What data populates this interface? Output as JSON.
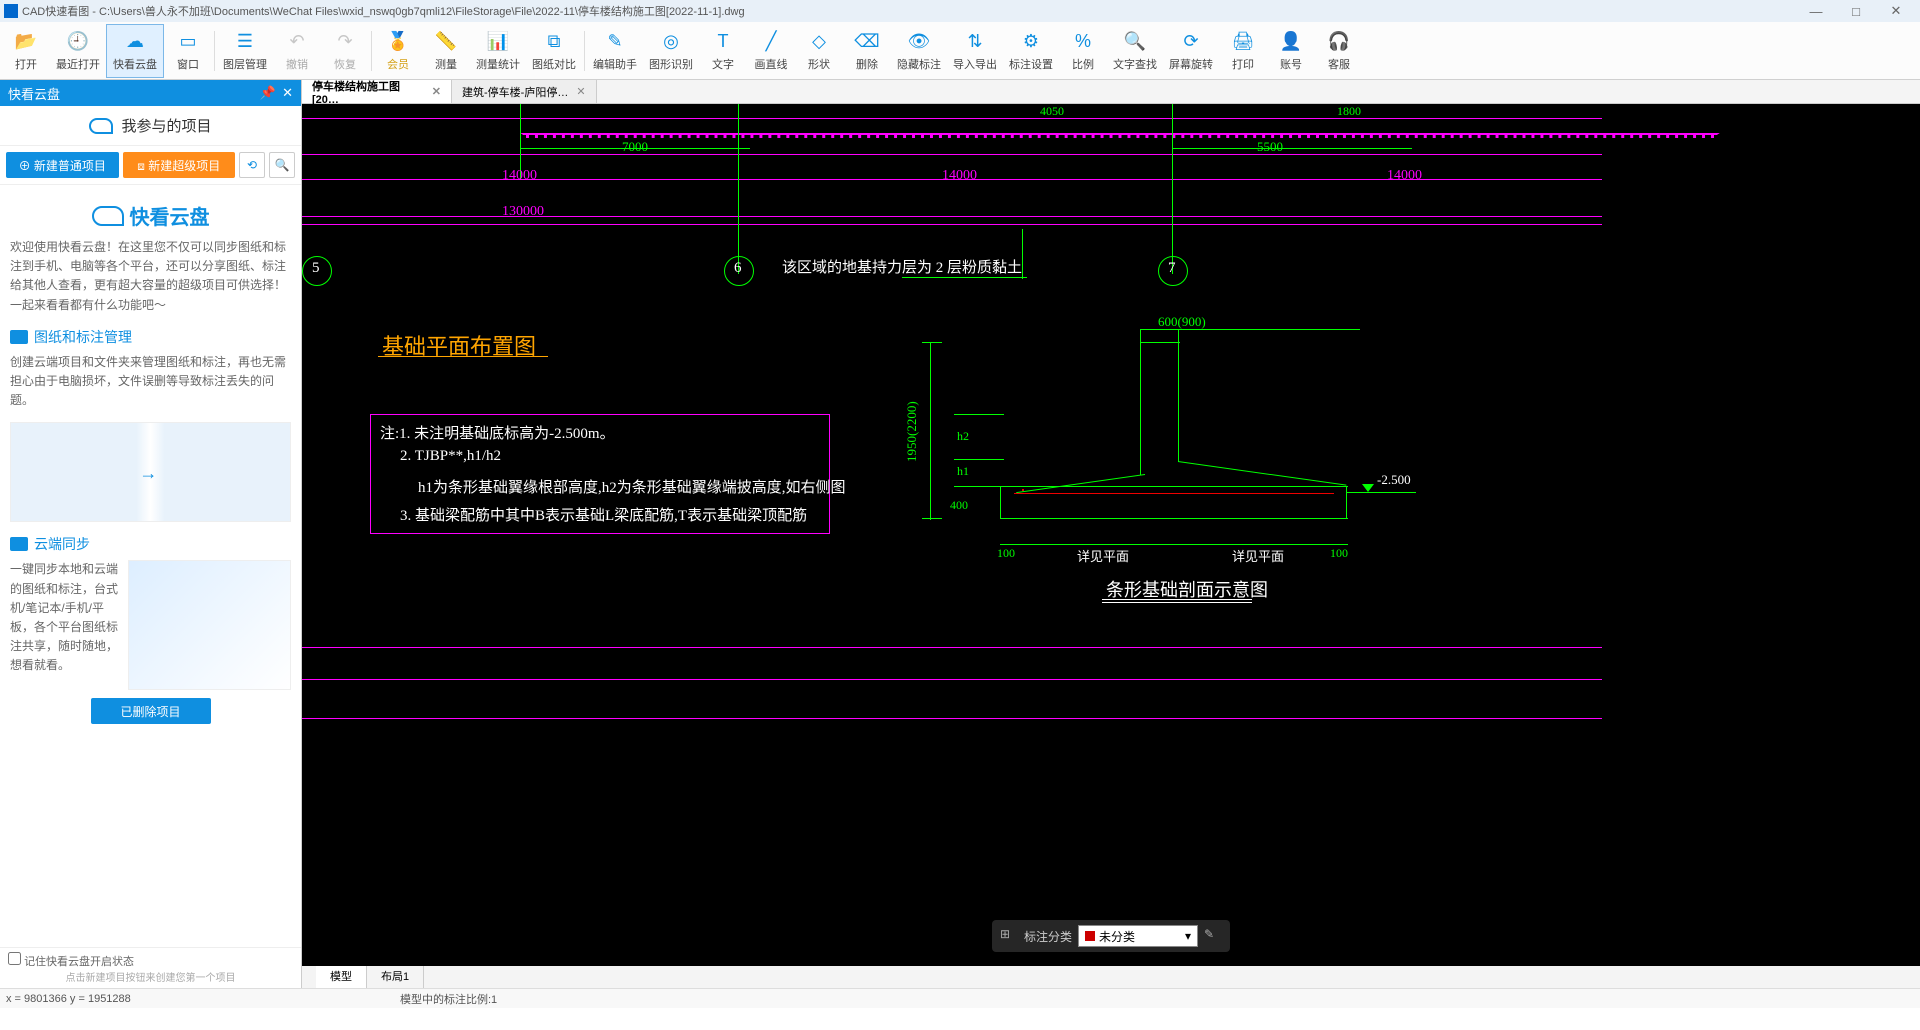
{
  "title": "CAD快速看图 - C:\\Users\\兽人永不加班\\Documents\\WeChat Files\\wxid_nswq0gb7qmli12\\FileStorage\\File\\2022-11\\停车楼结构施工图[2022-11-1].dwg",
  "toolbar": [
    {
      "label": "打开",
      "color": "#0f8fe0"
    },
    {
      "label": "最近打开",
      "color": "#0f8fe0"
    },
    {
      "label": "快看云盘",
      "color": "#0f8fe0"
    },
    {
      "label": "窗口",
      "color": "#0f8fe0"
    },
    {
      "label": "图层管理",
      "color": "#0f8fe0"
    },
    {
      "label": "撤销",
      "color": "#888",
      "disabled": true
    },
    {
      "label": "恢复",
      "color": "#888",
      "disabled": true
    },
    {
      "label": "会员",
      "color": "#d4a016"
    },
    {
      "label": "测量",
      "color": "#0f8fe0"
    },
    {
      "label": "测量统计",
      "color": "#0f8fe0"
    },
    {
      "label": "图纸对比",
      "color": "#0f8fe0"
    },
    {
      "label": "编辑助手",
      "color": "#0f8fe0"
    },
    {
      "label": "图形识别",
      "color": "#0f8fe0"
    },
    {
      "label": "文字",
      "color": "#0f8fe0"
    },
    {
      "label": "画直线",
      "color": "#0f8fe0"
    },
    {
      "label": "形状",
      "color": "#0f8fe0"
    },
    {
      "label": "删除",
      "color": "#0f8fe0"
    },
    {
      "label": "隐藏标注",
      "color": "#0f8fe0"
    },
    {
      "label": "导入导出",
      "color": "#0f8fe0"
    },
    {
      "label": "标注设置",
      "color": "#0f8fe0"
    },
    {
      "label": "比例",
      "color": "#0f8fe0"
    },
    {
      "label": "文字查找",
      "color": "#0f8fe0"
    },
    {
      "label": "屏幕旋转",
      "color": "#0f8fe0"
    },
    {
      "label": "打印",
      "color": "#0f8fe0"
    },
    {
      "label": "账号",
      "color": "#0f8fe0"
    },
    {
      "label": "客服",
      "color": "#0f8fe0"
    }
  ],
  "sidebar": {
    "header": "快看云盘",
    "proj_title": "我参与的项目",
    "btn_new_normal": "⊕ 新建普通项目",
    "btn_new_super": "⧈ 新建超级项目",
    "cloud_title": "快看云盘",
    "cloud_desc": "欢迎使用快看云盘！在这里您不仅可以同步图纸和标注到手机、电脑等各个平台，还可以分享图纸、标注给其他人查看，更有超大容量的超级项目可供选择！一起来看看都有什么功能吧～",
    "sec1_title": "图纸和标注管理",
    "sec1_desc": "创建云端项目和文件夹来管理图纸和标注，再也无需担心由于电脑损坏，文件误删等导致标注丢失的问题。",
    "sec2_title": "云端同步",
    "sec2_desc": "一键同步本地和云端的图纸和标注，台式机/笔记本/手机/平板，各个平台图纸标注共享，随时随地，想看就看。",
    "delete_btn": "已删除项目",
    "remember_cb": "记住快看云盘开启状态",
    "hint": "点击新建项目按钮来创建您第一个项目"
  },
  "tabs": {
    "t1": "停车楼结构施工图[20…",
    "t2": "建筑-停车楼-庐阳停…"
  },
  "bottom_tabs": {
    "t1": "模型",
    "t2": "布局1"
  },
  "floatbar": {
    "label": "标注分类",
    "sel": "未分类"
  },
  "status": {
    "coords": "x = 9801366  y = 1951288",
    "ratio": "模型中的标注比例:1"
  },
  "drawing": {
    "title": "基础平面布置图",
    "dims": {
      "d7000": "7000",
      "d5500": "5500",
      "d14000_l": "14000",
      "d14000_m": "14000",
      "d14000_r": "14000",
      "d130000": "130000",
      "d4050": "4050",
      "d1800": "1800"
    },
    "axes": {
      "c5": "5",
      "c6": "6",
      "c7": "7"
    },
    "text_soil": "该区域的地基持力层为    2    层粉质黏土",
    "notes": {
      "n1": "注:1.  未注明基础底标高为-2.500m。",
      "n2": "2.  TJBP**,h1/h2",
      "n2b": "h1为条形基础翼缘根部高度,h2为条形基础翼缘端披高度,如右侧图",
      "n3": "3.  基础梁配筋中其中B表示基础L梁底配筋,T表示基础梁顶配筋"
    },
    "detail": {
      "title": "条形基础剖面示意图",
      "d600": "600(900)",
      "d1950": "1950(2200)",
      "d100l": "100",
      "d100r": "100",
      "h1": "h1",
      "h2": "h2",
      "h400": "400",
      "see_plan_l": "详见平面",
      "see_plan_r": "详见平面",
      "elev": "-2.500"
    }
  }
}
